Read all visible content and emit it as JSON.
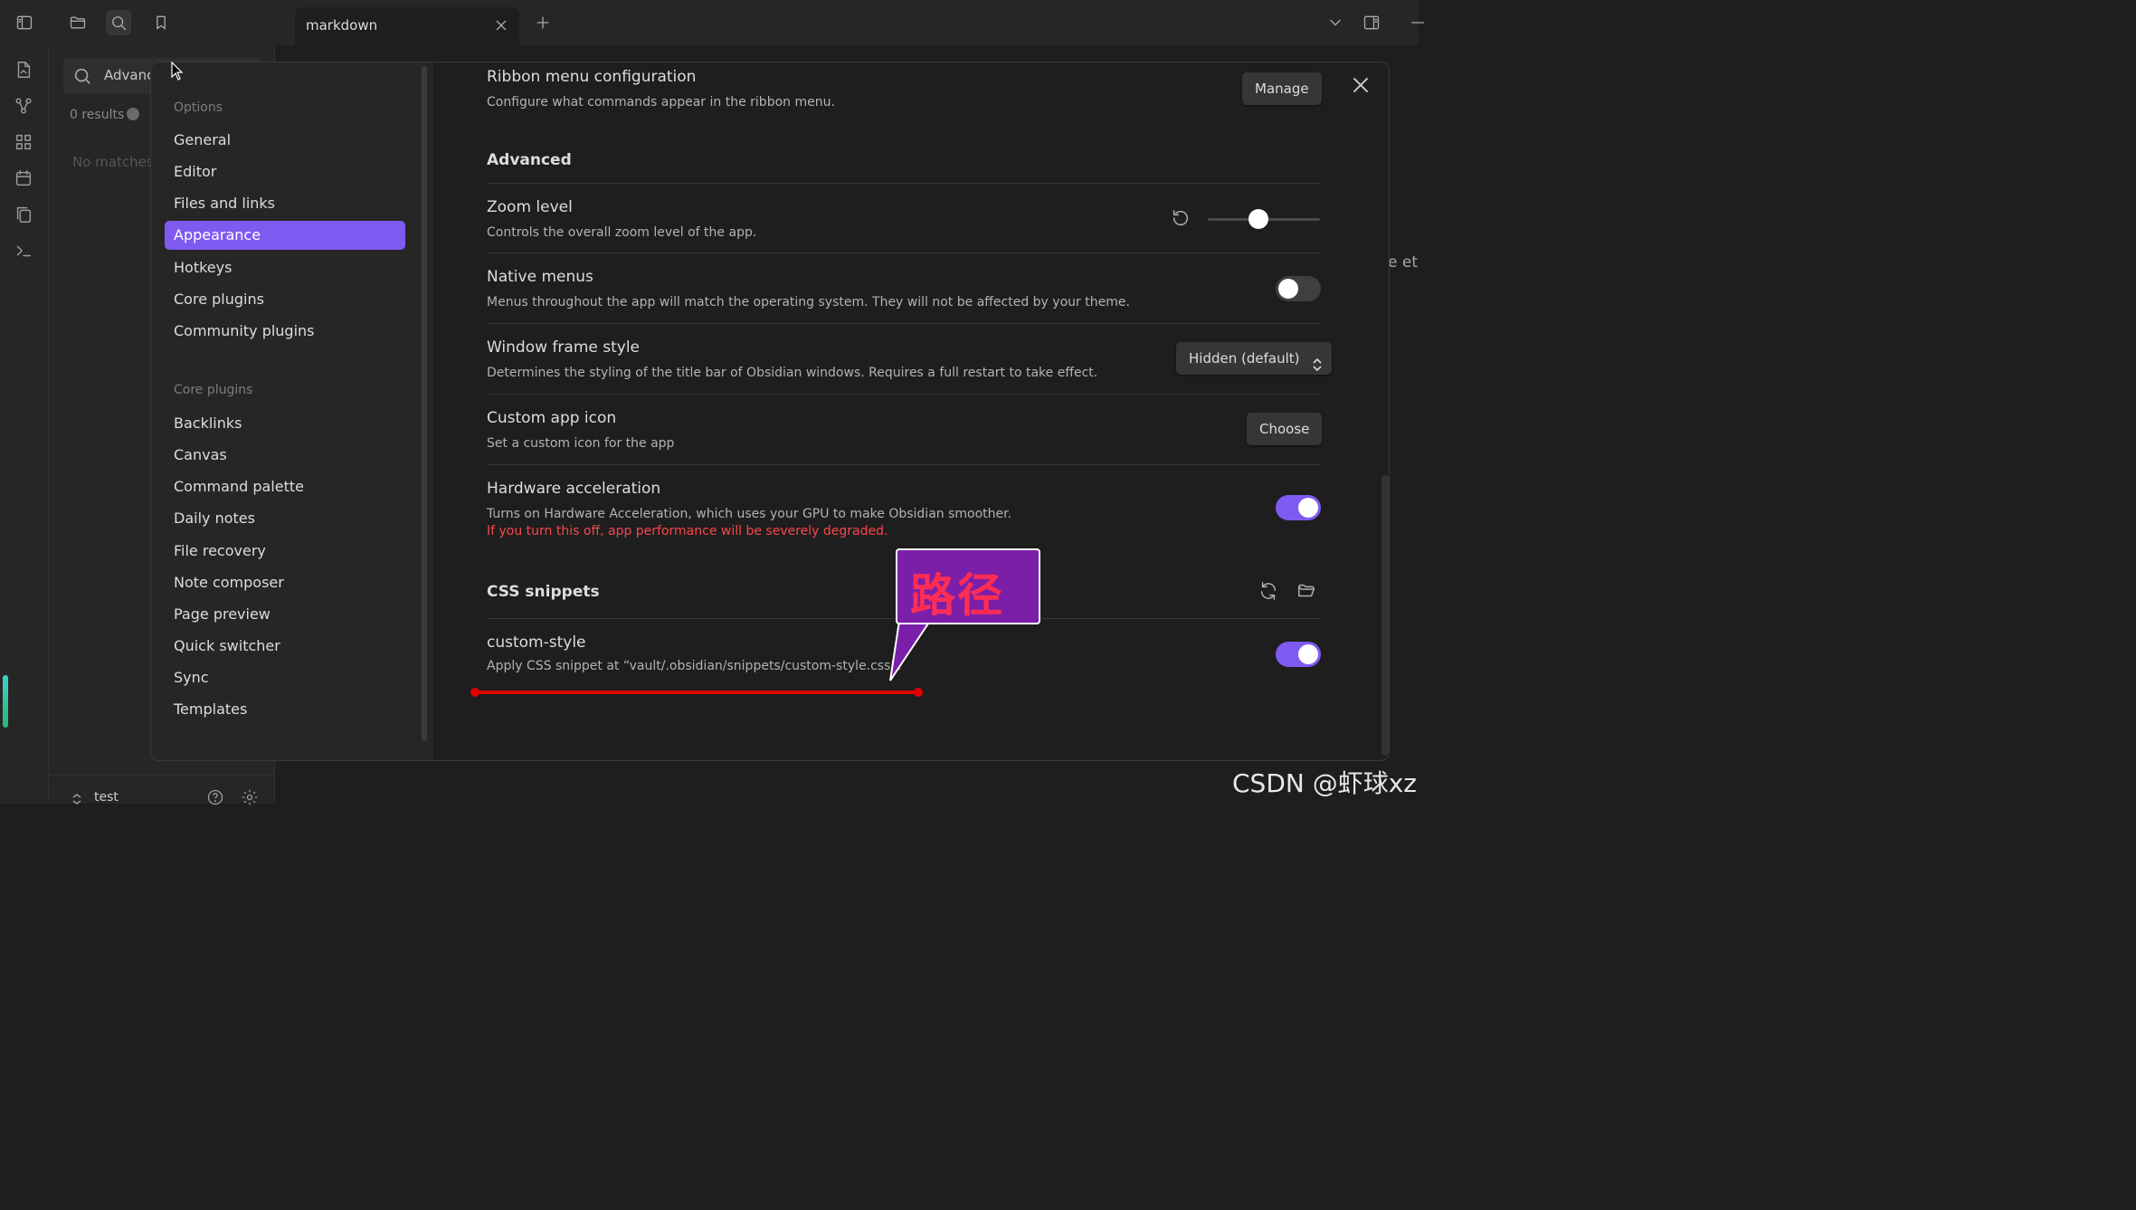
{
  "topbar": {
    "tab_title": "markdown"
  },
  "search_pane": {
    "query": "Advanc",
    "results": "0 results",
    "no_matches": "No matches",
    "vault_name": "test"
  },
  "background_text": "e et",
  "settings": {
    "nav": {
      "options_heading": "Options",
      "options_items": [
        "General",
        "Editor",
        "Files and links",
        "Appearance",
        "Hotkeys",
        "Core plugins",
        "Community plugins"
      ],
      "active_item": "Appearance",
      "core_plugins_heading": "Core plugins",
      "core_plugin_items": [
        "Backlinks",
        "Canvas",
        "Command palette",
        "Daily notes",
        "File recovery",
        "Note composer",
        "Page preview",
        "Quick switcher",
        "Sync",
        "Templates"
      ]
    },
    "ribbon": {
      "name": "Ribbon menu configuration",
      "desc": "Configure what commands appear in the ribbon menu.",
      "button": "Manage"
    },
    "advanced_heading": "Advanced",
    "zoom": {
      "name": "Zoom level",
      "desc": "Controls the overall zoom level of the app.",
      "level_fraction": 0.45
    },
    "native_menus": {
      "name": "Native menus",
      "desc": "Menus throughout the app will match the operating system. They will not be affected by your theme.",
      "enabled": false
    },
    "window_frame": {
      "name": "Window frame style",
      "desc": "Determines the styling of the title bar of Obsidian windows. Requires a full restart to take effect.",
      "value": "Hidden (default)"
    },
    "custom_icon": {
      "name": "Custom app icon",
      "desc": "Set a custom icon for the app",
      "button": "Choose"
    },
    "hardware_accel": {
      "name": "Hardware acceleration",
      "desc": "Turns on Hardware Acceleration, which uses your GPU to make Obsidian smoother.",
      "warning": "If you turn this off, app performance will be severely degraded.",
      "enabled": true
    },
    "css_heading": "CSS snippets",
    "snippet": {
      "name": "custom-style",
      "desc": "Apply CSS snippet at “vault/.obsidian/snippets/custom-style.css”.",
      "enabled": true
    }
  },
  "annotation": {
    "callout_text": "路径"
  },
  "watermark": "CSDN @虾球xz",
  "colors": {
    "accent": "#7f5af0",
    "warning": "#fb464c",
    "annotation_red": "#e00000",
    "callout_bg": "#7b1fa8"
  }
}
